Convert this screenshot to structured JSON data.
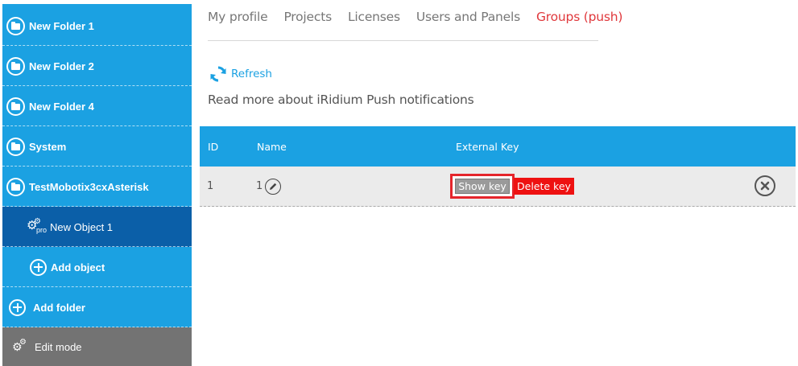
{
  "sidebar": {
    "folders": [
      {
        "label": "New Folder 1"
      },
      {
        "label": "New Folder 2"
      },
      {
        "label": "New Folder 4"
      },
      {
        "label": "System"
      },
      {
        "label": "TestMobotix3cxAsterisk"
      }
    ],
    "object": {
      "label": "New Object 1",
      "badge": "pro"
    },
    "add_object": "Add object",
    "add_folder": "Add folder",
    "edit_mode": "Edit mode",
    "colors": {
      "item": "#1ba1e2",
      "selected": "#0b5fa8",
      "edit": "#737373"
    }
  },
  "tabs": [
    {
      "label": "My profile",
      "active": false
    },
    {
      "label": "Projects",
      "active": false
    },
    {
      "label": "Licenses",
      "active": false
    },
    {
      "label": "Users and Panels",
      "active": false
    },
    {
      "label": "Groups (push)",
      "active": true
    }
  ],
  "refresh_label": "Refresh",
  "read_more": "Read more about iRidium Push notifications",
  "table": {
    "headers": {
      "id": "ID",
      "name": "Name",
      "external_key": "External Key"
    },
    "rows": [
      {
        "id": "1",
        "name": "1",
        "show_key": "Show key",
        "delete_key": "Delete key"
      }
    ]
  },
  "colors": {
    "accent": "#1ba1e2",
    "active_tab": "#e0383c",
    "delete": "#ee1111",
    "highlight_box": "#e5252b"
  }
}
